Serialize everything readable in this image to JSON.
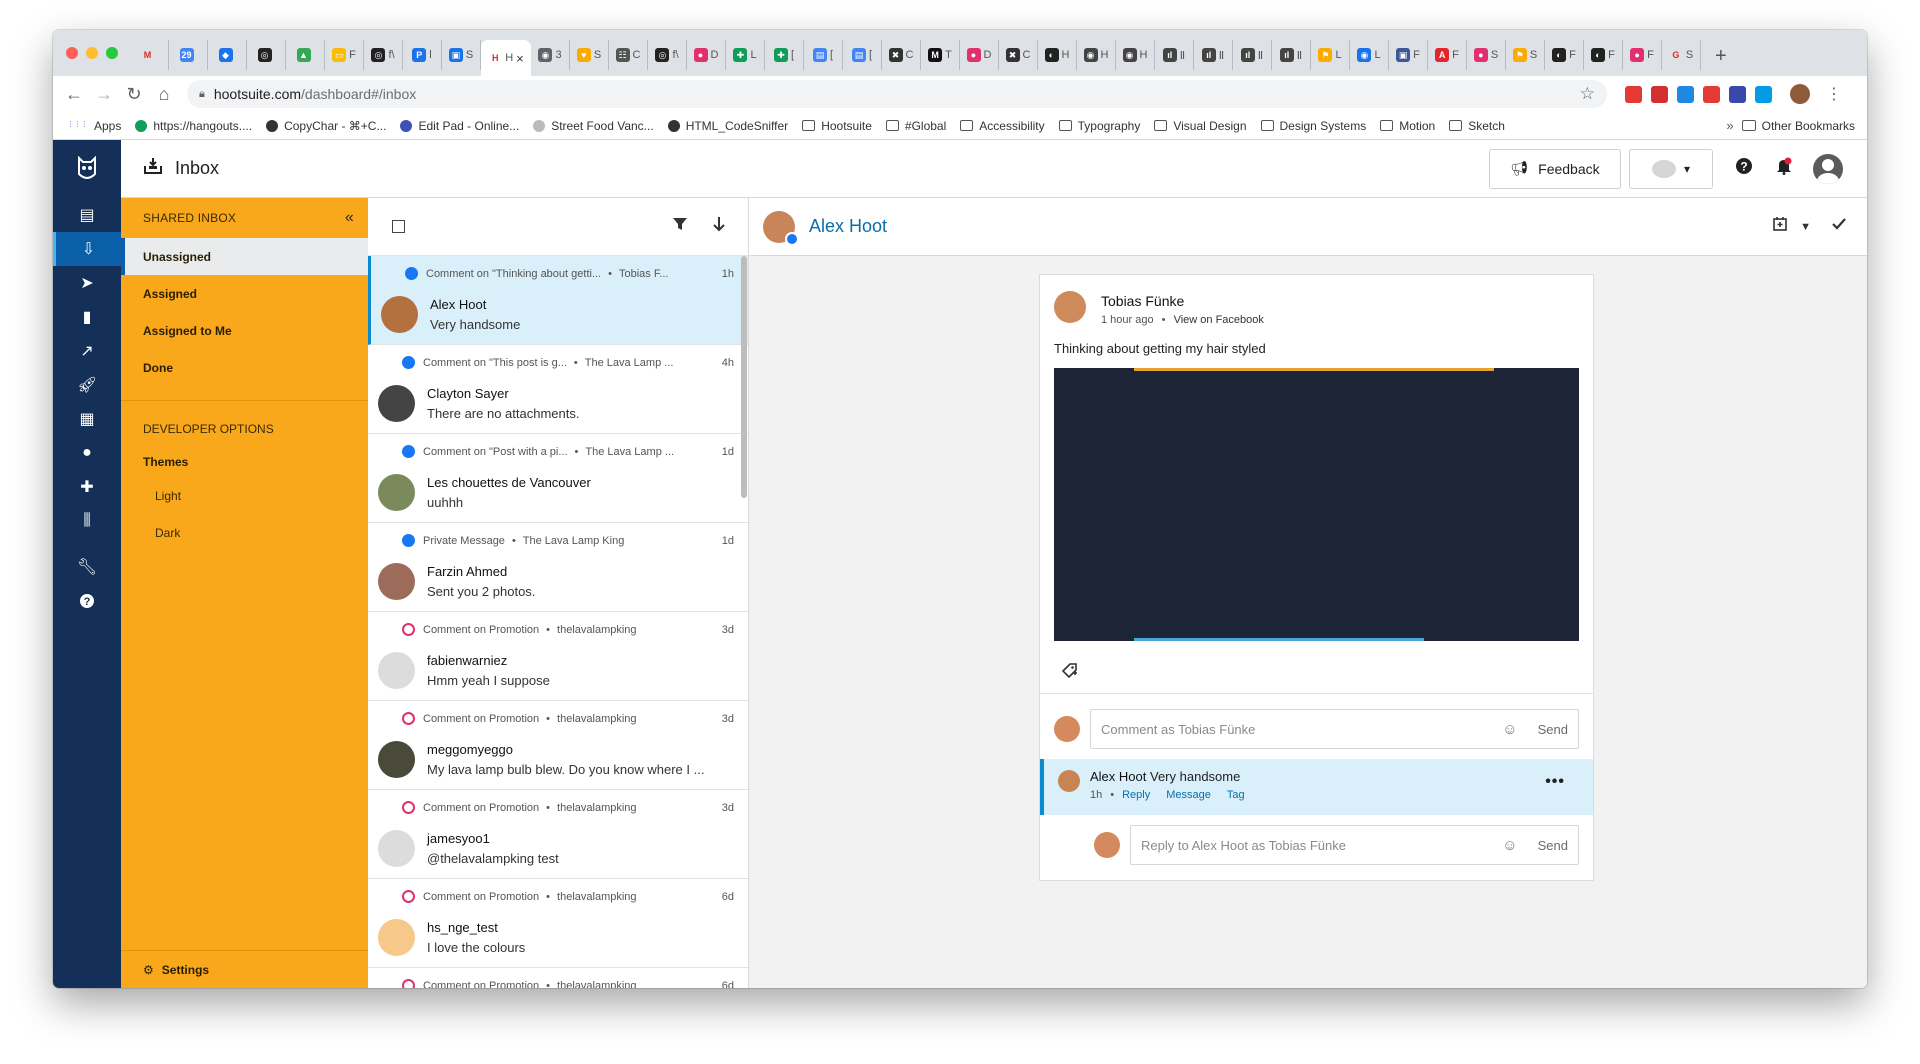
{
  "browser": {
    "tabs": [
      {
        "label": "",
        "color": "#ffffff",
        "icon": "gmail-icon",
        "glyph": "M"
      },
      {
        "label": "",
        "color": "#4285f4",
        "icon": "calendar-icon",
        "glyph": "29"
      },
      {
        "label": "",
        "color": "#1a73e8",
        "icon": "diamond-icon",
        "glyph": "◆"
      },
      {
        "label": "",
        "color": "#222222",
        "icon": "github-icon",
        "glyph": "◎"
      },
      {
        "label": "",
        "color": "#34a853",
        "icon": "drive-icon",
        "glyph": "▲"
      },
      {
        "label": "F",
        "color": "#fbbc04",
        "icon": "slides-icon",
        "glyph": "▭"
      },
      {
        "label": "f\\",
        "color": "#222222",
        "icon": "github-icon",
        "glyph": "◎"
      },
      {
        "label": "l",
        "color": "#1a73e8",
        "icon": "p-icon",
        "glyph": "P"
      },
      {
        "label": "S",
        "color": "#1a73e8",
        "icon": "app-icon",
        "glyph": "▣"
      },
      {
        "label": "H",
        "color": "#ffffff",
        "icon": "hootsuite-icon",
        "glyph": "H",
        "active": true
      },
      {
        "label": "3",
        "color": "#5f6368",
        "icon": "globe-icon",
        "glyph": "◉"
      },
      {
        "label": "S",
        "color": "#f9ab00",
        "icon": "heart-icon",
        "glyph": "♥"
      },
      {
        "label": "C",
        "color": "#555555",
        "icon": "grid-icon",
        "glyph": "☷"
      },
      {
        "label": "f\\",
        "color": "#222222",
        "icon": "github-icon",
        "glyph": "◎"
      },
      {
        "label": "D",
        "color": "#e1306c",
        "icon": "dribbble-icon",
        "glyph": "●"
      },
      {
        "label": "L",
        "color": "#0f9d58",
        "icon": "sheets-icon",
        "glyph": "✚"
      },
      {
        "label": "[",
        "color": "#0f9d58",
        "icon": "sheets-icon",
        "glyph": "✚"
      },
      {
        "label": "[",
        "color": "#4285f4",
        "icon": "docs-icon",
        "glyph": "▤"
      },
      {
        "label": "[",
        "color": "#4285f4",
        "icon": "docs-icon",
        "glyph": "▤"
      },
      {
        "label": "C",
        "color": "#333333",
        "icon": "x-icon",
        "glyph": "✖"
      },
      {
        "label": "T",
        "color": "#111111",
        "icon": "medium-icon",
        "glyph": "M"
      },
      {
        "label": "D",
        "color": "#e1306c",
        "icon": "dribbble-icon",
        "glyph": "●"
      },
      {
        "label": "C",
        "color": "#333333",
        "icon": "x-icon",
        "glyph": "✖"
      },
      {
        "label": "H",
        "color": "#222222",
        "icon": "owl-icon",
        "glyph": "◐"
      },
      {
        "label": "H",
        "color": "#444444",
        "icon": "globe-icon",
        "glyph": "◉"
      },
      {
        "label": "H",
        "color": "#444444",
        "icon": "globe-icon",
        "glyph": "◉"
      },
      {
        "label": "Ⅱ",
        "color": "#444444",
        "icon": "bars-icon",
        "glyph": "ıl"
      },
      {
        "label": "Ⅱ",
        "color": "#444444",
        "icon": "bars-icon",
        "glyph": "ıl"
      },
      {
        "label": "Ⅱ",
        "color": "#444444",
        "icon": "bars-icon",
        "glyph": "ıl"
      },
      {
        "label": "Ⅱ",
        "color": "#444444",
        "icon": "bars-icon",
        "glyph": "ıl"
      },
      {
        "label": "L",
        "color": "#f9ab00",
        "icon": "flag-icon",
        "glyph": "⚑"
      },
      {
        "label": "L",
        "color": "#1a73e8",
        "icon": "globe-icon",
        "glyph": "◉"
      },
      {
        "label": "F",
        "color": "#3b5998",
        "icon": "app-icon",
        "glyph": "▣"
      },
      {
        "label": "F",
        "color": "#e1272c",
        "icon": "adobe-icon",
        "glyph": "A"
      },
      {
        "label": "S",
        "color": "#e1306c",
        "icon": "dribbble-icon",
        "glyph": "●"
      },
      {
        "label": "S",
        "color": "#f9ab00",
        "icon": "flag-icon",
        "glyph": "⚑"
      },
      {
        "label": "F",
        "color": "#222222",
        "icon": "owl-icon",
        "glyph": "◐"
      },
      {
        "label": "F",
        "color": "#222222",
        "icon": "owl-icon",
        "glyph": "◐"
      },
      {
        "label": "F",
        "color": "#e1306c",
        "icon": "dribbble-icon",
        "glyph": "●"
      },
      {
        "label": "S",
        "color": "#ffffff",
        "icon": "google-icon",
        "glyph": "G"
      }
    ],
    "active_tab_close": "×",
    "new_tab": "+",
    "url_host": "hootsuite.com",
    "url_path": "/dashboard#/inbox",
    "extensions": [
      "#e53935",
      "#d32f2f",
      "#1e88e5",
      "#e53935",
      "#3949ab",
      "#039be5"
    ],
    "bookmarks": [
      {
        "label": "Apps",
        "type": "apps"
      },
      {
        "label": "https://hangouts....",
        "type": "site",
        "color": "#0f9d58"
      },
      {
        "label": "CopyChar - ⌘+C...",
        "type": "site",
        "color": "#333333"
      },
      {
        "label": "Edit Pad - Online...",
        "type": "site",
        "color": "#3f51b5"
      },
      {
        "label": "Street Food Vanc...",
        "type": "site",
        "color": "#bbbbbb"
      },
      {
        "label": "HTML_CodeSniffer",
        "type": "site",
        "color": "#333333"
      },
      {
        "label": "Hootsuite",
        "type": "folder"
      },
      {
        "label": "#Global",
        "type": "folder"
      },
      {
        "label": "Accessibility",
        "type": "folder"
      },
      {
        "label": "Typography",
        "type": "folder"
      },
      {
        "label": "Visual Design",
        "type": "folder"
      },
      {
        "label": "Design Systems",
        "type": "folder"
      },
      {
        "label": "Motion",
        "type": "folder"
      },
      {
        "label": "Sketch",
        "type": "folder"
      }
    ],
    "bookmarks_more": "»",
    "other_bookmarks": "Other Bookmarks"
  },
  "header": {
    "title": "Inbox",
    "feedback_label": "Feedback"
  },
  "rail": {
    "items": [
      "streams-icon",
      "inbox-icon",
      "publisher-icon",
      "analytics-icon",
      "trends-icon",
      "boost-icon",
      "assignments-icon",
      "insights-icon",
      "apps-icon",
      "audio-icon"
    ],
    "bottom_items": [
      "tools-icon",
      "help-icon"
    ]
  },
  "panel": {
    "shared_inbox": "SHARED INBOX",
    "items": [
      {
        "label": "Unassigned",
        "active": true
      },
      {
        "label": "Assigned"
      },
      {
        "label": "Assigned to Me"
      },
      {
        "label": "Done"
      }
    ],
    "developer_options": "DEVELOPER OPTIONS",
    "themes": "Themes",
    "theme_options": [
      "Light",
      "Dark"
    ],
    "settings": "Settings"
  },
  "messages": [
    {
      "network": "facebook",
      "context": "Comment on \"Thinking about getti...",
      "account": "Tobias F...",
      "time": "1h",
      "name": "Alex Hoot",
      "text": "Very handsome",
      "avatar": "#b5703f",
      "selected": true
    },
    {
      "network": "facebook",
      "context": "Comment on \"This post is g...",
      "account": "The Lava Lamp ...",
      "time": "4h",
      "name": "Clayton Sayer",
      "text": "There are no attachments.",
      "avatar": "#444444"
    },
    {
      "network": "facebook",
      "context": "Comment on \"Post with a pi...",
      "account": "The Lava Lamp ...",
      "time": "1d",
      "name": "Les chouettes de Vancouver",
      "text": "uuhhh",
      "avatar": "#7a8a5a"
    },
    {
      "network": "facebook",
      "context": "Private Message",
      "account": "The Lava Lamp King",
      "time": "1d",
      "name": "Farzin Ahmed",
      "text": "Sent you 2 photos.",
      "avatar": "#9c6b5a"
    },
    {
      "network": "instagram",
      "context": "Comment on Promotion",
      "account": "thelavalampking",
      "time": "3d",
      "name": "fabienwarniez",
      "text": "Hmm yeah I suppose",
      "avatar": "#dcdcdc"
    },
    {
      "network": "instagram",
      "context": "Comment on Promotion",
      "account": "thelavalampking",
      "time": "3d",
      "name": "meggomyeggo",
      "text": "My lava lamp bulb blew. Do you know where I ...",
      "avatar": "#4a4a3a"
    },
    {
      "network": "instagram",
      "context": "Comment on Promotion",
      "account": "thelavalampking",
      "time": "3d",
      "name": "jamesyoo1",
      "text": "@thelavalampking test",
      "avatar": "#dcdcdc"
    },
    {
      "network": "instagram",
      "context": "Comment on Promotion",
      "account": "thelavalampking",
      "time": "6d",
      "name": "hs_nge_test",
      "text": "I love the colours",
      "avatar": "#f6c88a"
    },
    {
      "network": "instagram",
      "context": "Comment on Promotion",
      "account": "thelavalampking",
      "time": "6d",
      "name": "",
      "text": "",
      "avatar": "#dcdcdc"
    }
  ],
  "detail": {
    "name": "Alex Hoot",
    "post": {
      "author": "Tobias Fünke",
      "time": "1 hour ago",
      "view_link": "View on Facebook",
      "text": "Thinking about getting my hair styled"
    },
    "comment_placeholder": "Comment as Tobias Fünke",
    "send": "Send",
    "reply": {
      "name": "Alex Hoot",
      "text": "Very handsome",
      "time": "1h",
      "actions": [
        "Reply",
        "Message",
        "Tag"
      ]
    },
    "reply_placeholder": "Reply to Alex Hoot as Tobias Fünke"
  }
}
